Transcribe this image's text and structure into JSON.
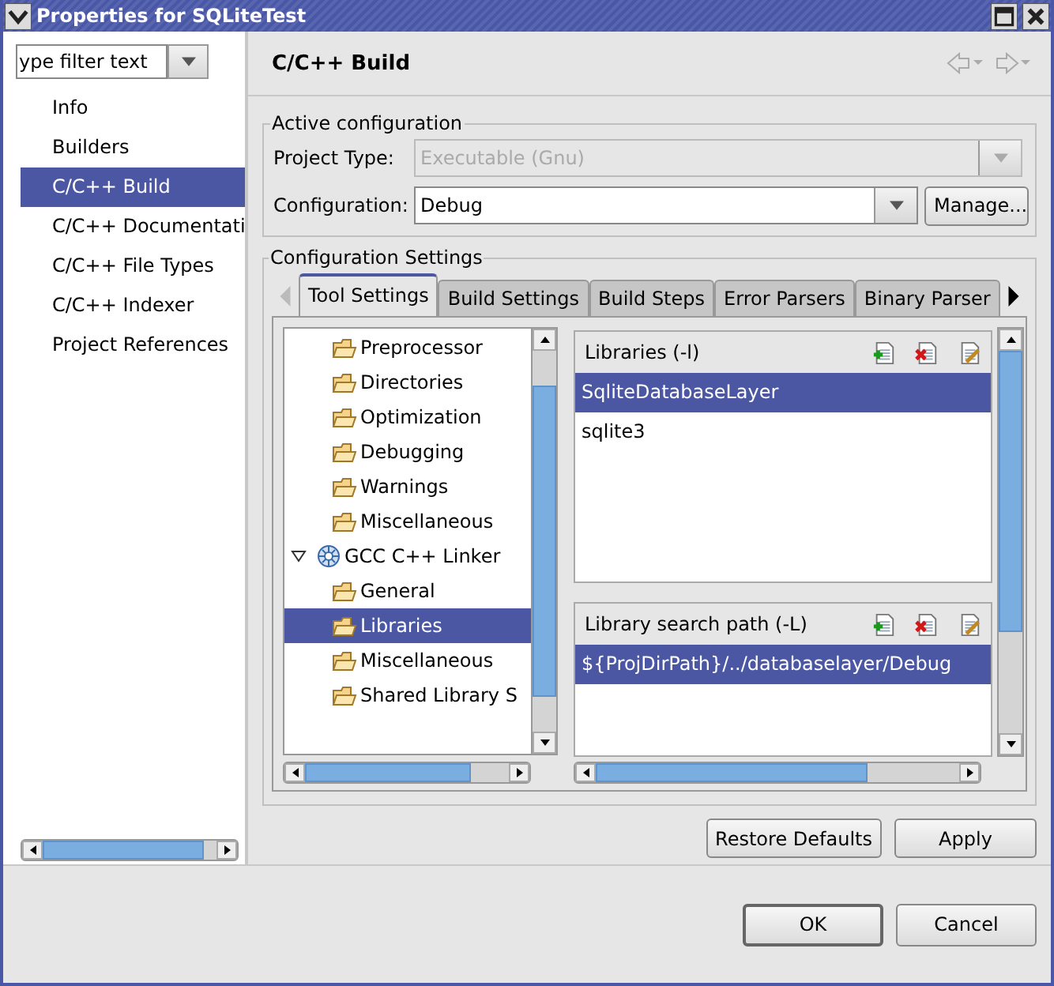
{
  "window": {
    "title": "Properties for SQLiteTest"
  },
  "filter": {
    "value": "ype filter text"
  },
  "nav": [
    {
      "label": "Info",
      "selected": false
    },
    {
      "label": "Builders",
      "selected": false
    },
    {
      "label": "C/C++ Build",
      "selected": true
    },
    {
      "label": "C/C++ Documentati",
      "selected": false
    },
    {
      "label": "C/C++ File Types",
      "selected": false
    },
    {
      "label": "C/C++ Indexer",
      "selected": false
    },
    {
      "label": "Project References",
      "selected": false
    }
  ],
  "page": {
    "title": "C/C++ Build"
  },
  "active_configuration": {
    "title": "Active configuration",
    "fields": [
      {
        "label": "Project Type:",
        "value": "Executable (Gnu)",
        "disabled": true
      },
      {
        "label": "Configuration:",
        "value": "Debug",
        "disabled": false
      }
    ],
    "manage_button": "Manage..."
  },
  "configuration_settings": {
    "title": "Configuration Settings",
    "tabs": [
      {
        "label": "Tool Settings",
        "selected": true
      },
      {
        "label": "Build Settings",
        "selected": false
      },
      {
        "label": "Build Steps",
        "selected": false
      },
      {
        "label": "Error Parsers",
        "selected": false
      },
      {
        "label": "Binary Parser",
        "selected": false
      }
    ],
    "tool_tree": [
      {
        "label": "Preprocessor",
        "kind": "option",
        "selected": false
      },
      {
        "label": "Directories",
        "kind": "option",
        "selected": false
      },
      {
        "label": "Optimization",
        "kind": "option",
        "selected": false
      },
      {
        "label": "Debugging",
        "kind": "option",
        "selected": false
      },
      {
        "label": "Warnings",
        "kind": "option",
        "selected": false
      },
      {
        "label": "Miscellaneous",
        "kind": "option",
        "selected": false
      },
      {
        "label": "GCC C++ Linker",
        "kind": "tool",
        "expanded": true,
        "selected": false,
        "children": [
          {
            "label": "General",
            "kind": "option",
            "selected": false
          },
          {
            "label": "Libraries",
            "kind": "option",
            "selected": true
          },
          {
            "label": "Miscellaneous",
            "kind": "option",
            "selected": false
          },
          {
            "label": "Shared Library S",
            "kind": "option",
            "selected": false
          }
        ]
      }
    ],
    "lists": [
      {
        "title": "Libraries (-l)",
        "items": [
          {
            "label": "SqliteDatabaseLayer",
            "selected": true
          },
          {
            "label": "sqlite3",
            "selected": false
          }
        ]
      },
      {
        "title": "Library search path (-L)",
        "items": [
          {
            "label": "${ProjDirPath}/../databaselayer/Debug",
            "selected": true
          }
        ]
      }
    ]
  },
  "buttons": {
    "restore": "Restore Defaults",
    "apply": "Apply",
    "ok": "OK",
    "cancel": "Cancel"
  }
}
